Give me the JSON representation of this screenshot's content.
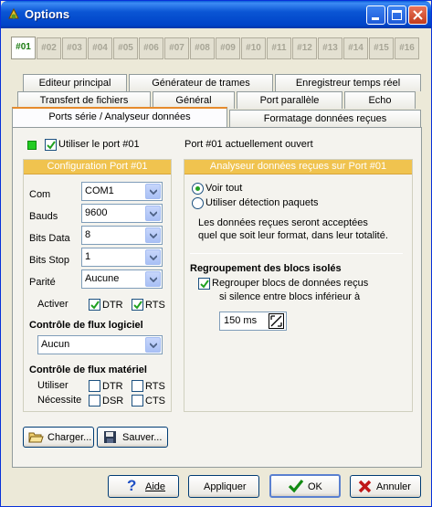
{
  "window": {
    "title": "Options"
  },
  "port_tabs": [
    "#01",
    "#02",
    "#03",
    "#04",
    "#05",
    "#06",
    "#07",
    "#08",
    "#09",
    "#10",
    "#11",
    "#12",
    "#13",
    "#14",
    "#15",
    "#16"
  ],
  "tabs": {
    "row1": [
      "Editeur principal",
      "Générateur de trames",
      "Enregistreur temps réel"
    ],
    "row2": [
      "Transfert de fichiers",
      "Général",
      "Port parallèle",
      "Echo"
    ],
    "row3": [
      "Ports série / Analyseur données",
      "Formatage données reçues"
    ]
  },
  "port": {
    "use_label": "Utiliser le port #01",
    "status": "Port #01 actuellement ouvert"
  },
  "config": {
    "header": "Configuration Port #01",
    "com_label": "Com",
    "com_value": "COM1",
    "bauds_label": "Bauds",
    "bauds_value": "9600",
    "bits_data_label": "Bits Data",
    "bits_data_value": "8",
    "bits_stop_label": "Bits Stop",
    "bits_stop_value": "1",
    "parite_label": "Parité",
    "parite_value": "Aucune",
    "activer_label": "Activer",
    "dtr": "DTR",
    "rts": "RTS",
    "soft_flow_title": "Contrôle de flux logiciel",
    "soft_flow_value": "Aucun",
    "hard_flow_title": "Contrôle de flux matériel",
    "utiliser_label": "Utiliser",
    "necessite_label": "Nécessite",
    "h_dtr": "DTR",
    "h_rts": "RTS",
    "h_dsr": "DSR",
    "h_cts": "CTS"
  },
  "analyzer": {
    "header": "Analyseur données reçues sur Port #01",
    "radio_all": "Voir tout",
    "radio_detect": "Utiliser détection paquets",
    "info_line1": "Les données reçues seront acceptées",
    "info_line2": "quel que soit leur format, dans leur totalité.",
    "group_title": "Regroupement des blocs isolés",
    "group_check_line1": "Regrouper blocs de données reçus",
    "group_check_line2": "si silence entre blocs inférieur à",
    "timeout_value": "150 ms"
  },
  "buttons": {
    "charger": "Charger...",
    "sauver": "Sauver...",
    "aide": "Aide",
    "appliquer": "Appliquer",
    "ok": "OK",
    "annuler": "Annuler"
  }
}
